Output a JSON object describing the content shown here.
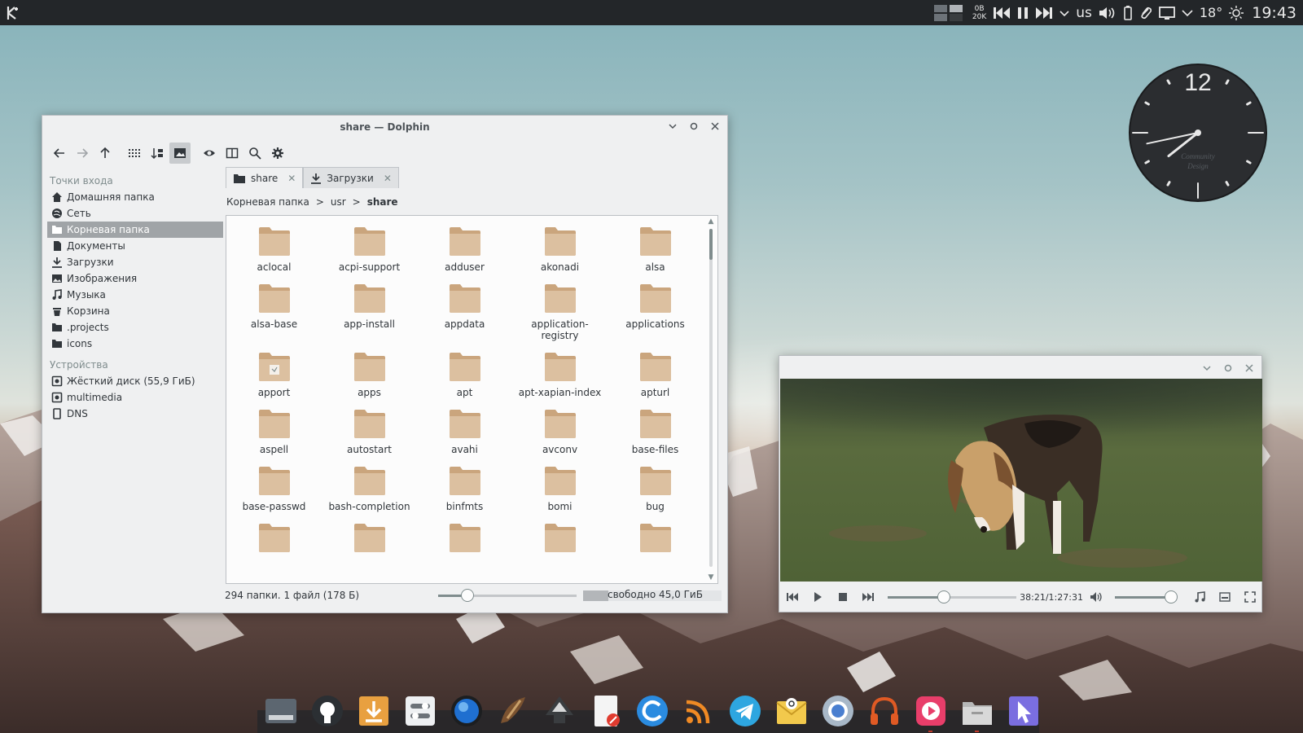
{
  "top_panel": {
    "net_up": "0B",
    "net_down": "20K",
    "keyboard_layout": "us",
    "temperature": "18°",
    "time": "19:43"
  },
  "analog_clock": {
    "numeral_12": "12",
    "watermark_line1": "Community",
    "watermark_line2": "Design",
    "hour_hand_hours": 7.72,
    "minute_hand_minutes": 43
  },
  "dolphin": {
    "title": "share — Dolphin",
    "places": {
      "section_entry_points": "Точки входа",
      "section_devices": "Устройства",
      "entry_items": [
        {
          "label": "Домашняя папка",
          "icon": "home-icon"
        },
        {
          "label": "Сеть",
          "icon": "network-icon"
        },
        {
          "label": "Корневая папка",
          "icon": "folder-icon",
          "selected": true
        },
        {
          "label": "Документы",
          "icon": "documents-icon"
        },
        {
          "label": "Загрузки",
          "icon": "download-icon"
        },
        {
          "label": "Изображения",
          "icon": "image-icon"
        },
        {
          "label": "Музыка",
          "icon": "music-icon"
        },
        {
          "label": "Корзина",
          "icon": "trash-icon"
        },
        {
          "label": ".projects",
          "icon": "folder-icon"
        },
        {
          "label": "icons",
          "icon": "folder-icon"
        }
      ],
      "device_items": [
        {
          "label": "Жёсткий диск (55,9 ГиБ)",
          "icon": "harddisk-icon"
        },
        {
          "label": "multimedia",
          "icon": "harddisk-icon"
        },
        {
          "label": "DNS",
          "icon": "device-icon"
        }
      ]
    },
    "tabs": [
      {
        "label": "share",
        "icon": "folder-icon",
        "active": true
      },
      {
        "label": "Загрузки",
        "icon": "download-icon",
        "active": false
      }
    ],
    "breadcrumb": {
      "root": "Корневая папка",
      "mid": "usr",
      "current": "share",
      "separator": ">"
    },
    "files": [
      "aclocal",
      "acpi-support",
      "adduser",
      "akonadi",
      "alsa",
      "alsa-base",
      "app-install",
      "appdata",
      "application-registry",
      "applications",
      "apport",
      "apps",
      "apt",
      "apt-xapian-index",
      "apturl",
      "aspell",
      "autostart",
      "avahi",
      "avconv",
      "base-files",
      "base-passwd",
      "bash-completion",
      "binfmts",
      "bomi",
      "bug",
      "",
      "",
      "",
      "",
      ""
    ],
    "status": "294 папки. 1 файл (178 Б)",
    "zoom_fraction": 0.21,
    "free_space": "свободно 45,0 ГиБ",
    "used_fraction": 0.18
  },
  "player": {
    "time": "38:21/1:27:31",
    "seek_fraction": 0.44,
    "volume_fraction": 0.9
  },
  "dock": {
    "items": [
      {
        "icon": "system-monitor-icon",
        "color": "#5c6670",
        "running": false
      },
      {
        "icon": "github-icon",
        "color": "#2b2f33",
        "running": false
      },
      {
        "icon": "downloader-icon",
        "color": "#e8a040",
        "running": false
      },
      {
        "icon": "settings-icon",
        "color": "#eef0f2",
        "running": false
      },
      {
        "icon": "browser-globe-icon",
        "color": "#1f6fd0",
        "running": false
      },
      {
        "icon": "krita-icon",
        "color": "#7a5230",
        "running": false
      },
      {
        "icon": "inkscape-icon",
        "color": "#3a3d40",
        "running": false
      },
      {
        "icon": "text-editor-icon",
        "color": "#f4f4f4",
        "running": false
      },
      {
        "icon": "web-browser-icon",
        "color": "#2a8be0",
        "running": false
      },
      {
        "icon": "rss-icon",
        "color": "#f08a24",
        "running": false
      },
      {
        "icon": "telegram-icon",
        "color": "#2ea6e0",
        "running": false
      },
      {
        "icon": "mail-icon",
        "color": "#f2c94c",
        "running": false
      },
      {
        "icon": "chromium-icon",
        "color": "#4a7fd0",
        "running": false
      },
      {
        "icon": "headphones-icon",
        "color": "#e05a24",
        "running": false
      },
      {
        "icon": "media-player-icon",
        "color": "#e83e6a",
        "running": true
      },
      {
        "icon": "file-manager-icon",
        "color": "#d8d8d8",
        "running": true
      },
      {
        "icon": "cursor-app-icon",
        "color": "#7a6ee0",
        "running": false
      }
    ]
  }
}
